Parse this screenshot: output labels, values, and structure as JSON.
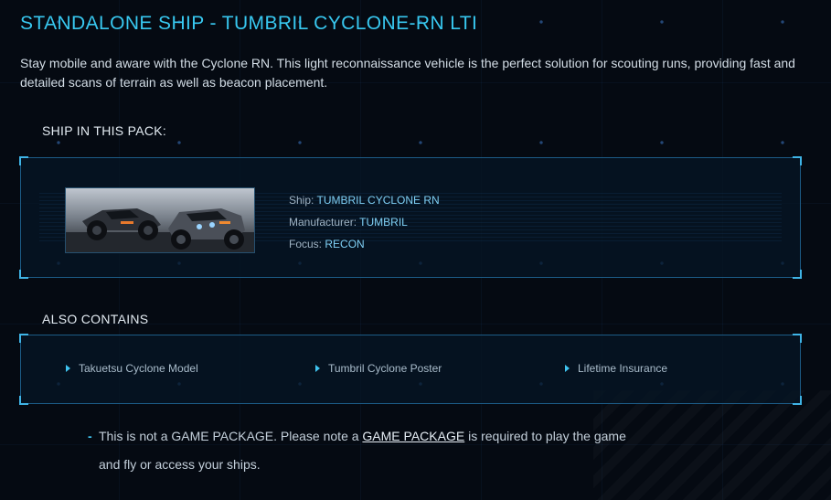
{
  "page": {
    "title": "STANDALONE SHIP - TUMBRIL CYCLONE-RN LTI",
    "description": "Stay mobile and aware with the Cyclone RN. This light reconnaissance vehicle is the perfect solution for scouting runs, providing fast and detailed scans of terrain as well as beacon placement."
  },
  "ship_section": {
    "heading": "SHIP IN THIS PACK:",
    "image_icon": "vehicle-image",
    "ship_label": "Ship:",
    "ship_value": "TUMBRIL CYCLONE RN",
    "manufacturer_label": "Manufacturer:",
    "manufacturer_value": "TUMBRIL",
    "focus_label": "Focus:",
    "focus_value": "RECON"
  },
  "also_contains": {
    "heading": "ALSO CONTAINS",
    "items": [
      "Takuetsu Cyclone Model",
      "Tumbril Cyclone Poster",
      "Lifetime Insurance"
    ]
  },
  "notice": {
    "dash": "-",
    "before": "This is not a GAME PACKAGE. Please note a ",
    "link": "GAME PACKAGE",
    "after": " is required to play the game and fly or access your ships."
  },
  "colors": {
    "accent": "#38c8f0",
    "background": "#050a12",
    "frame_border": "#1c5b86",
    "value_text": "#7fd0f5"
  }
}
